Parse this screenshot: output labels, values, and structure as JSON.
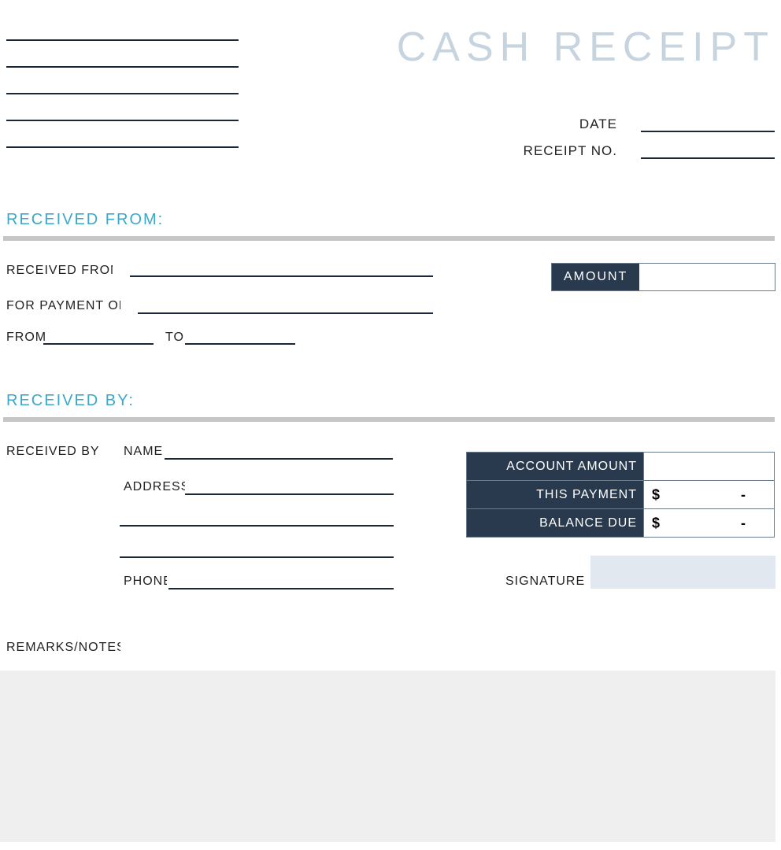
{
  "title": "CASH RECEIPT",
  "header": {
    "date_label": "DATE",
    "receipt_no_label": "RECEIPT NO."
  },
  "sections": {
    "received_from_title": "RECEIVED FROM:",
    "received_by_title": "RECEIVED BY:"
  },
  "from": {
    "received_from_label": "RECEIVED FROM",
    "for_payment_label": "FOR PAYMENT OF",
    "from_label": "FROM",
    "to_label": "TO",
    "amount_label": "AMOUNT"
  },
  "by": {
    "received_by_label": "RECEIVED BY",
    "name_label": "NAME",
    "address_label": "ADDRESS",
    "phone_label": "PHONE"
  },
  "summary": {
    "account_amount_label": "ACCOUNT AMOUNT",
    "this_payment_label": "THIS PAYMENT",
    "balance_due_label": "BALANCE DUE",
    "currency": "$",
    "dash": "-",
    "account_amount_value": "",
    "this_payment_value": "-",
    "balance_due_value": "-"
  },
  "signature_label": "SIGNATURE",
  "remarks_label": "REMARKS/NOTES"
}
